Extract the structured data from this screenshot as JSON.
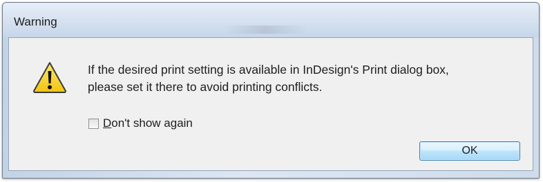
{
  "window": {
    "title": "Warning"
  },
  "dialog": {
    "icon": "warning-icon",
    "message_line1": "If the desired print setting is available in InDesign's Print dialog box,",
    "message_line2": "please set it there to avoid printing conflicts.",
    "checkbox": {
      "accel_char": "D",
      "label_rest": "on't show again",
      "checked": false
    },
    "ok_label": "OK"
  },
  "colors": {
    "warning_fill": "#f7d22a",
    "warning_border": "#3a3a3a",
    "button_border": "#3c7fb1"
  }
}
